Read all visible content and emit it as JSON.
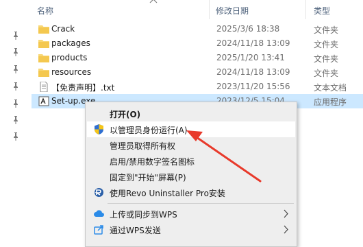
{
  "columns": {
    "name": "名称",
    "modified": "修改日期",
    "type": "类型"
  },
  "files": [
    {
      "name": "Crack",
      "modified": "2025/3/6 18:38",
      "type": "文件夹",
      "icon": "folder-icon"
    },
    {
      "name": "packages",
      "modified": "2024/11/18 13:09",
      "type": "文件夹",
      "icon": "folder-icon"
    },
    {
      "name": "products",
      "modified": "2025/1/20 13:41",
      "type": "文件夹",
      "icon": "folder-icon"
    },
    {
      "name": "resources",
      "modified": "2024/11/18 13:09",
      "type": "文件夹",
      "icon": "folder-icon"
    },
    {
      "name": "【免责声明】.txt",
      "modified": "2023/11/20 15:56",
      "type": "文本文档",
      "icon": "text-file-icon"
    },
    {
      "name": "Set-up.exe",
      "modified": "2023/12/5 15:04",
      "type": "应用程序",
      "icon": "exe-icon",
      "selected": true
    }
  ],
  "context_menu": {
    "items": [
      {
        "label": "打开(O)",
        "bold": true
      },
      {
        "label": "以管理员身份运行(A)",
        "icon": "uac-shield-icon",
        "hover": true
      },
      {
        "label": "管理员取得所有权"
      },
      {
        "label": "启用/禁用数字签名图标"
      },
      {
        "label": "固定到\"开始\"屏幕(P)"
      },
      {
        "label": "使用Revo Uninstaller Pro安装",
        "icon": "revo-uninstaller-icon"
      },
      {
        "label": "上传或同步到WPS",
        "icon": "wps-cloud-icon",
        "submenu": true
      },
      {
        "label": "通过WPS发送",
        "icon": "wps-share-icon",
        "submenu": true
      }
    ]
  },
  "colors": {
    "selection": "#cce8ff",
    "folder": "#f8d775",
    "annotation_arrow": "#e8392a"
  }
}
